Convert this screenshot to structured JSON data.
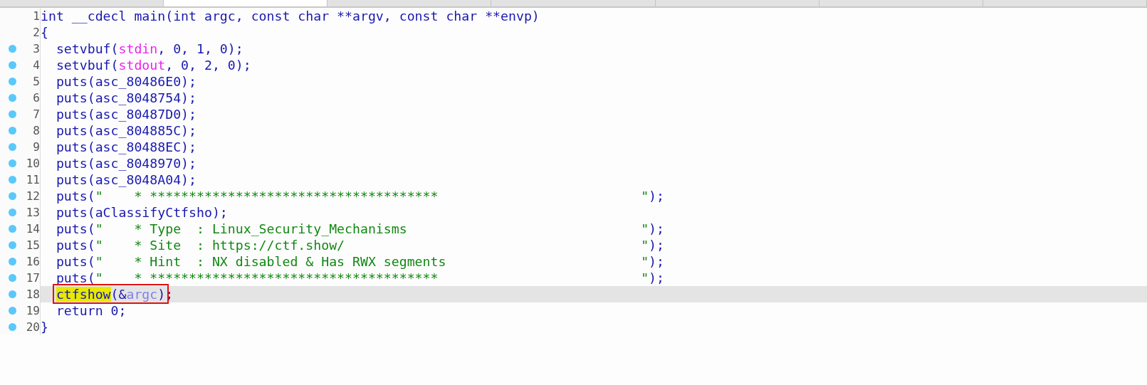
{
  "tabs": [
    {
      "selected": false
    },
    {
      "selected": true
    },
    {
      "selected": false
    },
    {
      "selected": false
    },
    {
      "selected": false
    },
    {
      "selected": false
    },
    {
      "selected": false
    }
  ],
  "lines": [
    {
      "number": "1",
      "breakpoint": false,
      "highlighted": false,
      "indented": false,
      "tokens": [
        {
          "text": "int __cdecl main(int argc, const char **argv, const char **envp)",
          "kind": "plain"
        }
      ]
    },
    {
      "number": "2",
      "breakpoint": false,
      "highlighted": false,
      "indented": false,
      "tokens": [
        {
          "text": "{",
          "kind": "plain"
        }
      ]
    },
    {
      "number": "3",
      "breakpoint": true,
      "highlighted": false,
      "indented": true,
      "tokens": [
        {
          "text": "setvbuf(",
          "kind": "plain"
        },
        {
          "text": "stdin",
          "kind": "global"
        },
        {
          "text": ", 0, 1, 0);",
          "kind": "plain"
        }
      ]
    },
    {
      "number": "4",
      "breakpoint": true,
      "highlighted": false,
      "indented": true,
      "tokens": [
        {
          "text": "setvbuf(",
          "kind": "plain"
        },
        {
          "text": "stdout",
          "kind": "global"
        },
        {
          "text": ", 0, 2, 0);",
          "kind": "plain"
        }
      ]
    },
    {
      "number": "5",
      "breakpoint": true,
      "highlighted": false,
      "indented": true,
      "tokens": [
        {
          "text": "puts(asc_80486E0);",
          "kind": "plain"
        }
      ]
    },
    {
      "number": "6",
      "breakpoint": true,
      "highlighted": false,
      "indented": true,
      "tokens": [
        {
          "text": "puts(asc_8048754);",
          "kind": "plain"
        }
      ]
    },
    {
      "number": "7",
      "breakpoint": true,
      "highlighted": false,
      "indented": true,
      "tokens": [
        {
          "text": "puts(asc_80487D0);",
          "kind": "plain"
        }
      ]
    },
    {
      "number": "8",
      "breakpoint": true,
      "highlighted": false,
      "indented": true,
      "tokens": [
        {
          "text": "puts(asc_804885C);",
          "kind": "plain"
        }
      ]
    },
    {
      "number": "9",
      "breakpoint": true,
      "highlighted": false,
      "indented": true,
      "tokens": [
        {
          "text": "puts(asc_80488EC);",
          "kind": "plain"
        }
      ]
    },
    {
      "number": "10",
      "breakpoint": true,
      "highlighted": false,
      "indented": true,
      "tokens": [
        {
          "text": "puts(asc_8048970);",
          "kind": "plain"
        }
      ]
    },
    {
      "number": "11",
      "breakpoint": true,
      "highlighted": false,
      "indented": true,
      "tokens": [
        {
          "text": "puts(asc_8048A04);",
          "kind": "plain"
        }
      ]
    },
    {
      "number": "12",
      "breakpoint": true,
      "highlighted": false,
      "indented": true,
      "tokens": [
        {
          "text": "puts(",
          "kind": "plain"
        },
        {
          "text": "\"    * *************************************                          \"",
          "kind": "string"
        },
        {
          "text": ");",
          "kind": "plain"
        }
      ]
    },
    {
      "number": "13",
      "breakpoint": true,
      "highlighted": false,
      "indented": true,
      "tokens": [
        {
          "text": "puts(aClassifyCtfsho);",
          "kind": "plain"
        }
      ]
    },
    {
      "number": "14",
      "breakpoint": true,
      "highlighted": false,
      "indented": true,
      "tokens": [
        {
          "text": "puts(",
          "kind": "plain"
        },
        {
          "text": "\"    * Type  : Linux_Security_Mechanisms                              \"",
          "kind": "string"
        },
        {
          "text": ");",
          "kind": "plain"
        }
      ]
    },
    {
      "number": "15",
      "breakpoint": true,
      "highlighted": false,
      "indented": true,
      "tokens": [
        {
          "text": "puts(",
          "kind": "plain"
        },
        {
          "text": "\"    * Site  : https://ctf.show/                                      \"",
          "kind": "string"
        },
        {
          "text": ");",
          "kind": "plain"
        }
      ]
    },
    {
      "number": "16",
      "breakpoint": true,
      "highlighted": false,
      "indented": true,
      "tokens": [
        {
          "text": "puts(",
          "kind": "plain"
        },
        {
          "text": "\"    * Hint  : NX disabled & Has RWX segments                         \"",
          "kind": "string"
        },
        {
          "text": ");",
          "kind": "plain"
        }
      ]
    },
    {
      "number": "17",
      "breakpoint": true,
      "highlighted": false,
      "indented": true,
      "tokens": [
        {
          "text": "puts(",
          "kind": "plain"
        },
        {
          "text": "\"    * *************************************                          \"",
          "kind": "string"
        },
        {
          "text": ");",
          "kind": "plain"
        }
      ]
    },
    {
      "number": "18",
      "breakpoint": true,
      "highlighted": true,
      "indented": true,
      "tokens": [
        {
          "text": "ctfshow",
          "kind": "match",
          "boxed": true
        },
        {
          "text": "(&",
          "kind": "plain",
          "boxed": true
        },
        {
          "text": "argc",
          "kind": "var",
          "boxed": true
        },
        {
          "text": ")",
          "kind": "plain",
          "boxed": true
        },
        {
          "text": ";",
          "kind": "plain"
        }
      ]
    },
    {
      "number": "19",
      "breakpoint": true,
      "highlighted": false,
      "indented": true,
      "tokens": [
        {
          "text": "return 0;",
          "kind": "plain"
        }
      ]
    },
    {
      "number": "20",
      "breakpoint": true,
      "highlighted": false,
      "indented": false,
      "tokens": [
        {
          "text": "}",
          "kind": "plain"
        }
      ]
    }
  ]
}
